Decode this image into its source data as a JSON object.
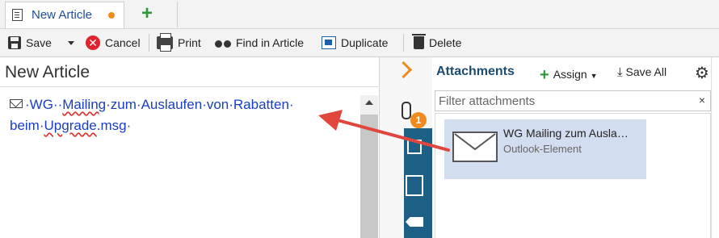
{
  "tab": {
    "title": "New Article",
    "new_tab_label": "+"
  },
  "toolbar": {
    "save": "Save",
    "cancel": "Cancel",
    "cancel_symbol": "✕",
    "print": "Print",
    "find": "Find in Article",
    "duplicate": "Duplicate",
    "delete": "Delete"
  },
  "article": {
    "title": "New Article",
    "line1_prefix": "·WG··",
    "line1_word": "Mailing",
    "line1_rest": "·zum·Auslaufen·von·Rabatten·",
    "line2_prefix": "beim·",
    "line2_word": "Upgrade",
    "line2_rest": ".msg·"
  },
  "rail": {
    "badge_count": "1"
  },
  "attachments": {
    "title": "Attachments",
    "assign_label": "Assign",
    "assign_plus": "+",
    "save_all_label": "Save All",
    "filter_placeholder": "Filter attachments",
    "clear_symbol": "×",
    "gear_symbol": "⚙",
    "items": [
      {
        "name": "WG  Mailing zum Ausla…",
        "type": "Outlook-Element"
      }
    ]
  },
  "colors": {
    "accent_orange": "#f08a1c",
    "link_blue": "#1a3ec2",
    "rail_dark": "#1e5f86",
    "selection": "#d2deef",
    "arrow_red": "#e0463c"
  }
}
